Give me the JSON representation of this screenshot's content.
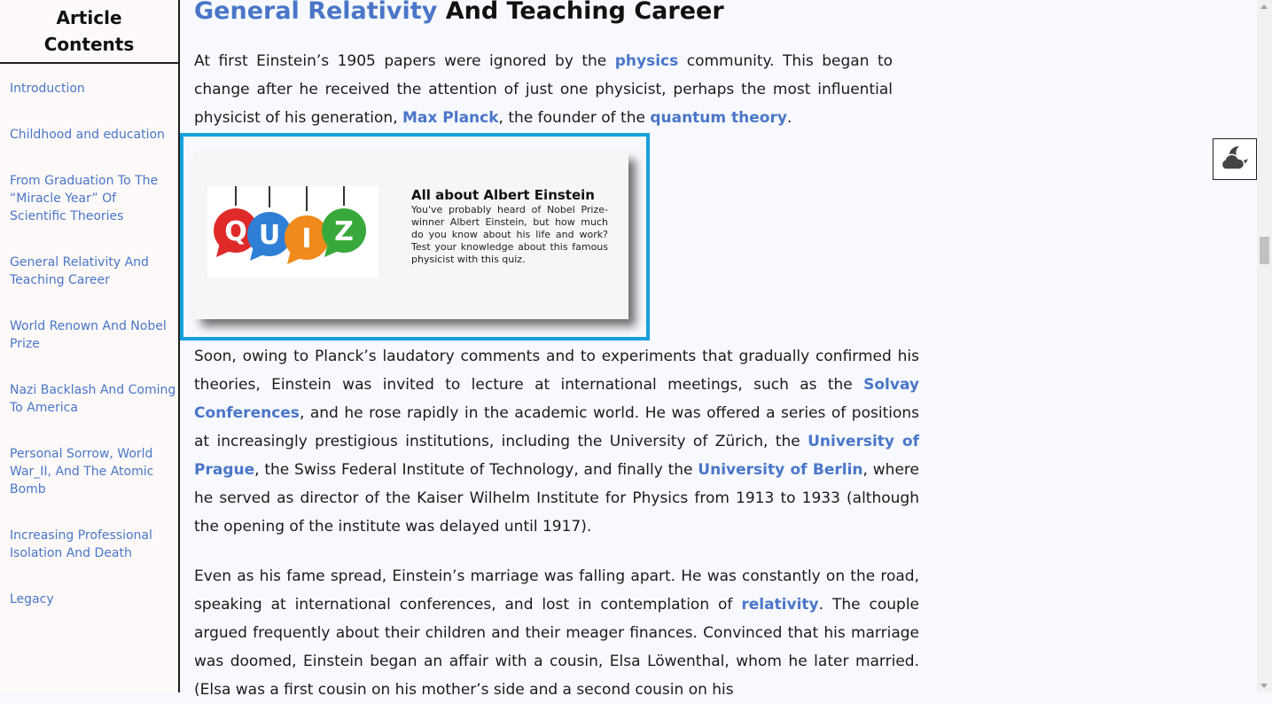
{
  "sidebar": {
    "title": "Article Contents",
    "items": [
      "Introduction",
      "Childhood and education",
      "From Graduation To The “Miracle Year” Of Scientific Theories",
      "General Relativity And Teaching Career",
      "World Renown And Nobel Prize",
      "Nazi Backlash And Coming To America",
      "Personal Sorrow, World War_II, And The Atomic Bomb",
      "Increasing Professional Isolation And Death",
      "Legacy"
    ]
  },
  "article": {
    "heading_link": "General Relativity",
    "heading_rest": " And Teaching Career",
    "p1": {
      "t1": "At first Einstein’s 1905 papers were ignored by the ",
      "l1": "physics",
      "t2": " community. This began to change after he received the attention of just one physicist, perhaps the most influential physicist of his generation, ",
      "l2": "Max Planck",
      "t3": ", the founder of the ",
      "l3": "quantum theory",
      "t4": "."
    },
    "p2": {
      "t1": "Soon, owing to Planck’s laudatory comments and to experiments that gradually confirmed his theories, Einstein was invited to lecture at international meetings, such as the ",
      "l1": "Solvay Conferences",
      "t2": ", and he rose rapidly in the academic world. He was offered a series of positions at increasingly prestigious institutions, including the University of Zürich, the ",
      "l2": "University of Prague",
      "t3": ", the Swiss Federal Institute of Technology, and finally the ",
      "l3": "University of Berlin",
      "t4": ", where he served as director of the Kaiser Wilhelm Institute for Physics from 1913 to 1933 (although the opening of the institute was delayed until 1917)."
    },
    "p3": {
      "t1": "Even as his fame spread, Einstein’s marriage was falling apart. He was constantly on the road, speaking at international conferences, and lost in contemplation of ",
      "l1": "relativity",
      "t2": ". The couple argued frequently about their children and their meager finances. Convinced that his marriage was doomed, Einstein began an affair with a cousin, Elsa Löwenthal, whom he later married. (Elsa was a first cousin on his mother’s side and a second cousin on his"
    }
  },
  "quiz": {
    "image_letters": [
      "Q",
      "U",
      "I",
      "Z"
    ],
    "image_colors": [
      "#e02a2a",
      "#2f7fd6",
      "#f08a1c",
      "#39a83a"
    ],
    "title": "All about Albert Einstein",
    "description": "You've probably heard of Nobel Prize-winner Albert Einstein, but how much do you know about his life and work? Test your knowledge about this famous physicist with this quiz."
  },
  "theme_toggle": {
    "icon": "moon-cloud-icon"
  },
  "colors": {
    "link": "#4a76c8",
    "quiz_border": "#17a0dc",
    "page_bg": "#f7f9fe",
    "sidebar_bg": "#fdf9f9"
  }
}
